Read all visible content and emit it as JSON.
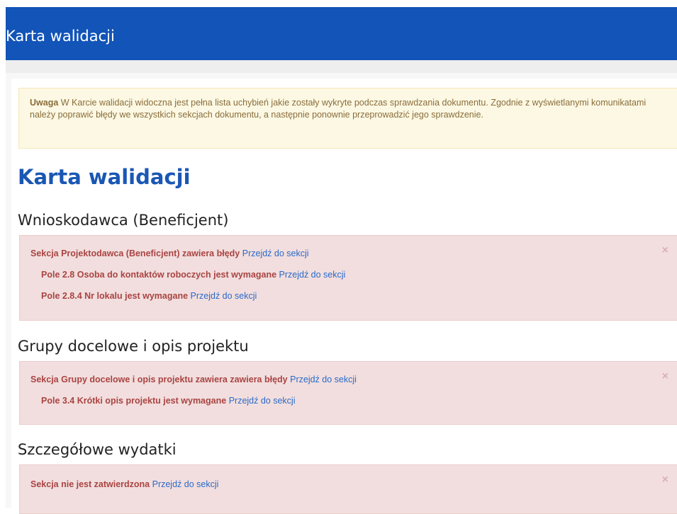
{
  "header": {
    "title": "Karta walidacji"
  },
  "warning": {
    "strong": "Uwaga",
    "text": " W Karcie walidacji widoczna jest pełna lista uchybień jakie zostały wykryte podczas sprawdzania dokumentu. Zgodnie z wyświetlanymi komunikatami należy poprawić błędy we wszystkich sekcjach dokumentu, a następnie ponownie przeprowadzić jego sprawdzenie."
  },
  "page_heading": "Karta walidacji",
  "sections": [
    {
      "title": "Wnioskodawca (Beneficjent)",
      "main_msg": "Sekcja Projektodawca (Beneficjent) zawiera błędy",
      "main_link": "Przejdź do sekcji",
      "items": [
        {
          "msg": "Pole 2.8 Osoba do kontaktów roboczych jest wymagane",
          "link": "Przejdź do sekcji"
        },
        {
          "msg": "Pole 2.8.4 Nr lokalu jest wymagane",
          "link": "Przejdź do sekcji"
        }
      ],
      "close": "×"
    },
    {
      "title": "Grupy docelowe i opis projektu",
      "main_msg": "Sekcja Grupy docelowe i opis projektu zawiera zawiera błędy",
      "main_link": "Przejdź do sekcji",
      "items": [
        {
          "msg": "Pole 3.4 Krótki opis projektu jest wymagane",
          "link": "Przejdź do sekcji"
        }
      ],
      "close": "×"
    },
    {
      "title": "Szczegółowe wydatki",
      "main_msg": "Sekcja nie jest zatwierdzona",
      "main_link": "Przejdź do sekcji",
      "items": [],
      "close": "×"
    }
  ]
}
